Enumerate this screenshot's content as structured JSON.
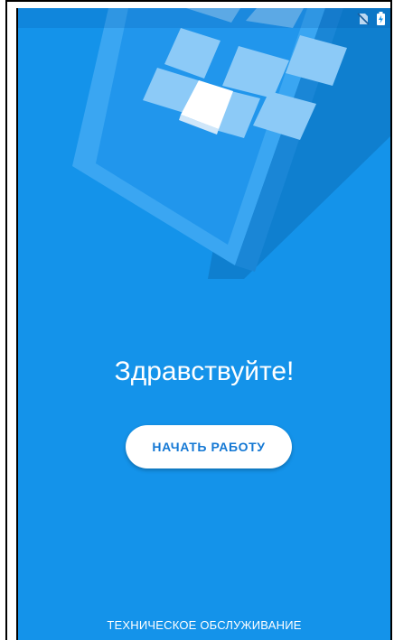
{
  "welcome": {
    "greeting": "Здравствуйте!",
    "start_button_label": "НАЧАТЬ РАБОТУ",
    "maintenance_label": "ТЕХНИЧЕСКОЕ ОБСЛУЖИВАНИЕ"
  },
  "status_bar": {
    "icons": [
      "no-sim-icon",
      "battery-charging-icon"
    ]
  },
  "colors": {
    "background": "#1493ea",
    "button_background": "#ffffff",
    "button_text": "#1478d4",
    "text": "#ffffff"
  }
}
